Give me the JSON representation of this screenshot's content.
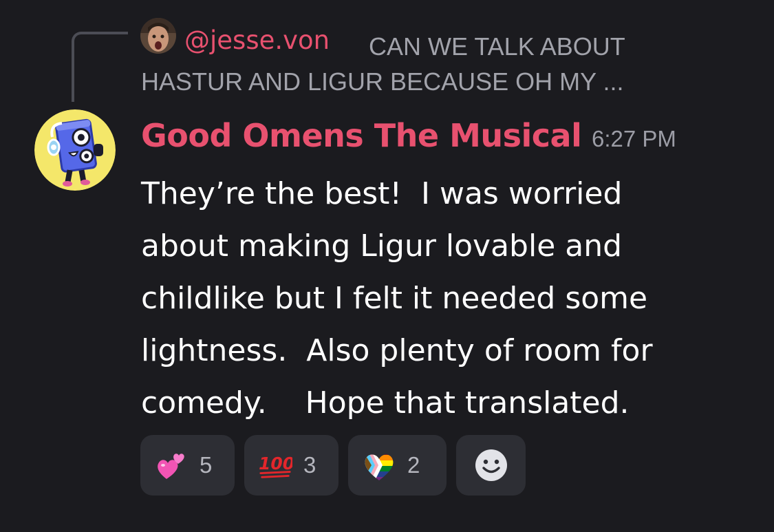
{
  "reply": {
    "username": "@jesse.von",
    "preview_line1": "CAN WE TALK ABOUT",
    "preview_line2": "HASTUR AND LIGUR BECAUSE OH MY ...",
    "avatar_icon": "user-avatar-photo"
  },
  "message": {
    "author": "Good Omens The Musical",
    "timestamp": "6:27 PM",
    "avatar_icon": "blue-speaker-mascot-avatar",
    "lines": [
      "They’re the best!  I was worried",
      "about making Ligur lovable and",
      "childlike but I felt it needed some",
      "lightness.  Also plenty of room for",
      "comedy.    Hope that translated."
    ]
  },
  "reactions": [
    {
      "emoji": "two-hearts-icon",
      "count": "5"
    },
    {
      "emoji": "hundred-points-icon",
      "count": "3"
    },
    {
      "emoji": "progress-pride-heart-icon",
      "count": "2"
    }
  ],
  "add_reaction": {
    "icon": "add-reaction-smiley-icon"
  },
  "colors": {
    "background": "#1b1b1f",
    "accent_name": "#e8516f",
    "muted_text": "#a2a3ab",
    "reaction_bg": "#2d2e34"
  }
}
